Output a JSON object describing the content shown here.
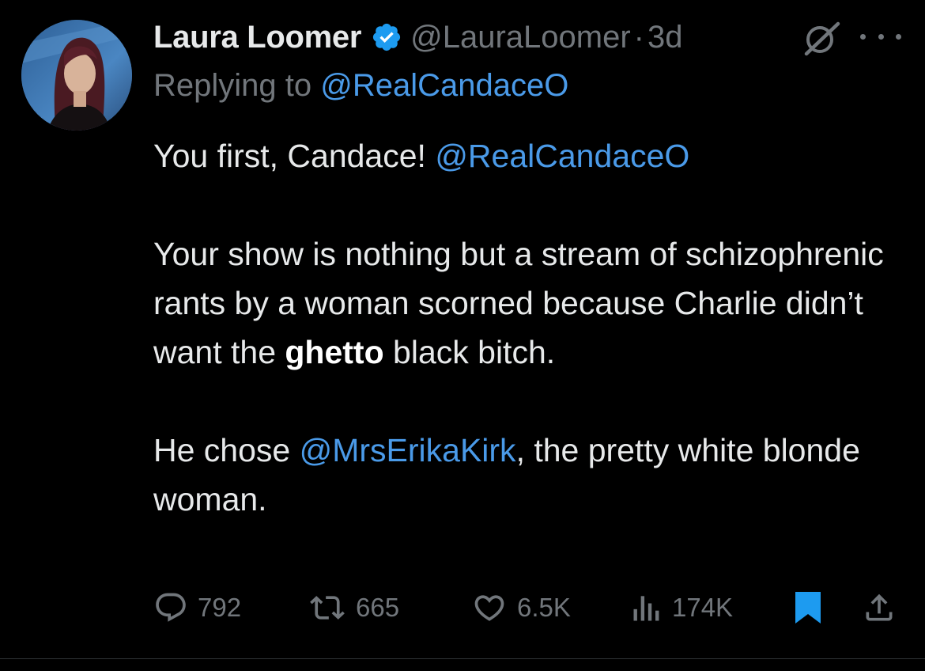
{
  "tweet": {
    "author": {
      "name": "Laura Loomer",
      "handle": "@LauraLoomer",
      "verified": true
    },
    "separator": "·",
    "time": "3d",
    "reply": {
      "prefix": "Replying to",
      "mention": "@RealCandaceO"
    },
    "body": {
      "line1_text": "You first, Candace! ",
      "line1_mention": "@RealCandaceO",
      "para2_text": "Your show is nothing but a stream of schizophrenic rants by a woman scorned because Charlie didn’t want the ",
      "para2_bold": "ghetto",
      "para2_end": " black bitch.",
      "para3_start": "He chose ",
      "para3_mention": "@MrsErikaKirk",
      "para3_end": ", the pretty white blonde woman."
    },
    "metrics": {
      "replies": "792",
      "reposts": "665",
      "likes": "6.5K",
      "views": "174K"
    },
    "icons": {
      "verified": "verified-badge-icon",
      "grok": "grok-icon",
      "more": "more-icon",
      "reply": "reply-icon",
      "repost": "repost-icon",
      "like": "like-icon",
      "views": "views-icon",
      "bookmark": "bookmark-icon",
      "share": "share-icon"
    },
    "colors": {
      "background": "#000000",
      "text": "#e7e9ea",
      "muted": "#71767b",
      "link": "#4a9ae8",
      "verified": "#1d9bf0",
      "bookmark": "#1d9bf0"
    }
  }
}
